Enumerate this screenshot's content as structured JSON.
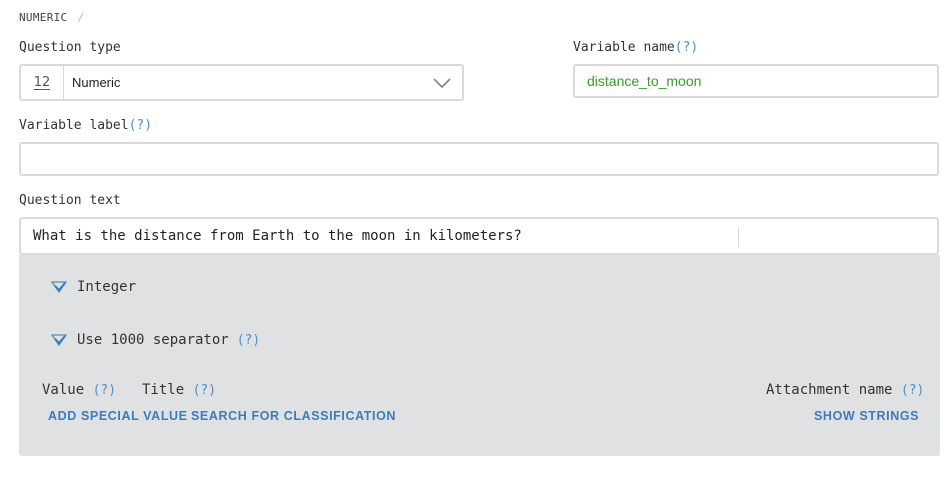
{
  "breadcrumb": {
    "item": "NUMERIC",
    "separator": "/"
  },
  "question_type": {
    "label": "Question type",
    "icon_text": "12",
    "value": "Numeric",
    "icon": "chevron-down-icon"
  },
  "variable_name": {
    "label": "Variable name",
    "help": "(?)",
    "value": "distance_to_moon"
  },
  "variable_label": {
    "label": "Variable label",
    "help": "(?)",
    "value": ""
  },
  "question_text": {
    "label": "Question text",
    "value": "What is the distance from Earth to the moon in kilometers?"
  },
  "options": {
    "integer": {
      "label": "Integer",
      "checked": true
    },
    "separator": {
      "label": "Use 1000 separator",
      "help": "(?)",
      "checked": true
    }
  },
  "special_values": {
    "value_header": "Value",
    "value_help": "(?)",
    "title_header": "Title",
    "title_help": "(?)",
    "attachment_header": "Attachment name",
    "attachment_help": "(?)",
    "add_special_value": "ADD SPECIAL VALUE",
    "search_classification": "SEARCH FOR CLASSIFICATION",
    "show_strings": "SHOW STRINGS"
  },
  "colors": {
    "accent": "#3a7cc0",
    "variable_value": "#3a9a2c",
    "panel_bg": "#e0e1e2"
  }
}
